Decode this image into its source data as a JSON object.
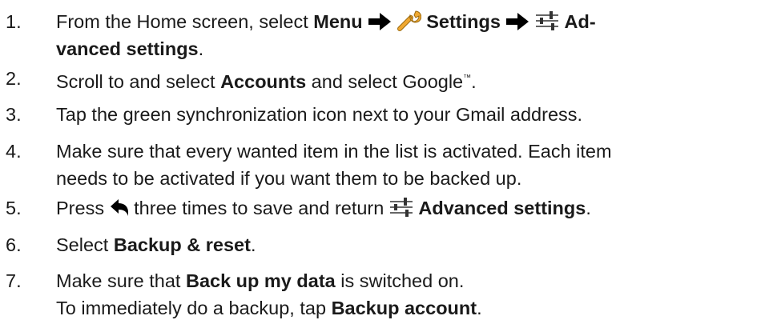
{
  "steps": [
    {
      "number": "1.",
      "t1": "From the Home screen, select ",
      "menu": "Menu",
      "settings": "Settings",
      "adv_a": "Ad-",
      "adv_b": "vanced settings",
      "end": "."
    },
    {
      "number": "2.",
      "t1": "Scroll to and select ",
      "accounts": "Accounts",
      "t2": " and select Google",
      "tm": "™",
      "end": "."
    },
    {
      "number": "3.",
      "text": "Tap the green synchronization icon next to your Gmail address."
    },
    {
      "number": "4.",
      "line1": "Make sure that every wanted item in the list is activated. Each item",
      "line2": "needs to be activated if you want them to be backed up."
    },
    {
      "number": "5.",
      "t1": "Press ",
      "t2": " three times to save and return ",
      "adv": "Advanced settings",
      "end": "."
    },
    {
      "number": "6.",
      "t1": "Select ",
      "backup_reset": "Backup & reset",
      "end": "."
    },
    {
      "number": "7.",
      "l1a": "Make sure that ",
      "l1b": "Back up my data",
      "l1c": " is switched on.",
      "l2a": "To immediately do a backup, tap ",
      "l2b": "Backup account",
      "end": "."
    }
  ],
  "icons": {
    "arrow": "arrow-right-icon",
    "wrench": "wrench-icon",
    "sliders": "sliders-icon",
    "back": "back-arrow-icon",
    "wrench_color": "#f0a830"
  }
}
